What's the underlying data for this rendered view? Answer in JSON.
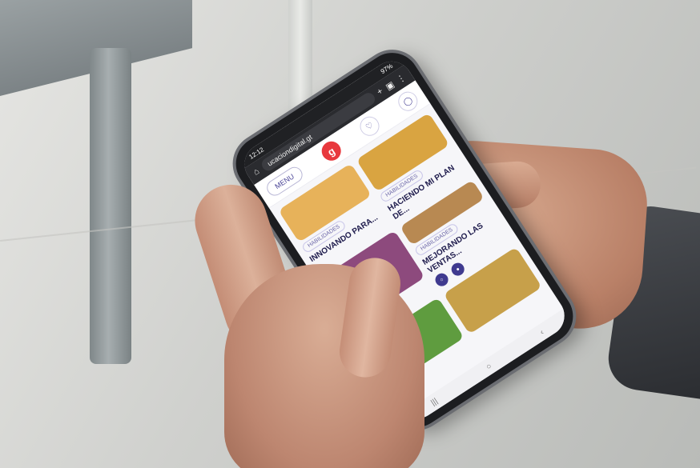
{
  "browser": {
    "status_time": "12:12",
    "battery": "97%",
    "url": "ucaciondigital.gt"
  },
  "site": {
    "menu_label": "MENU",
    "logo_text": "g"
  },
  "cards": [
    {
      "badge": "HABILIDADES",
      "title": "INNOVANDO PARA...",
      "meta": "",
      "thumb_color": "#e7b25a"
    },
    {
      "badge": "HABILIDADES",
      "title": "HACIENDO MI PLAN DE...",
      "meta": "",
      "thumb_color": "#d9a441"
    },
    {
      "badge": "",
      "title": "",
      "meta": "",
      "thumb_color": "#8d4a7d"
    },
    {
      "badge": "HABILIDADES",
      "title": "MEJORANDO LAS VENTAS...",
      "meta": "",
      "thumb_color": "#b88952"
    },
    {
      "badge": "",
      "title": "",
      "meta": "",
      "thumb_color": "#5f9c3f"
    },
    {
      "badge": "",
      "title": "",
      "meta": "",
      "thumb_color": "#c7a04a"
    }
  ],
  "icons": {
    "home": "home-icon",
    "tabs": "tabs-icon",
    "plus": "plus-icon",
    "more": "more-icon",
    "heart": "heart-icon",
    "user": "user-icon",
    "nav_back": "back-icon",
    "nav_home": "nav-home-icon",
    "nav_recent": "recent-icon"
  }
}
